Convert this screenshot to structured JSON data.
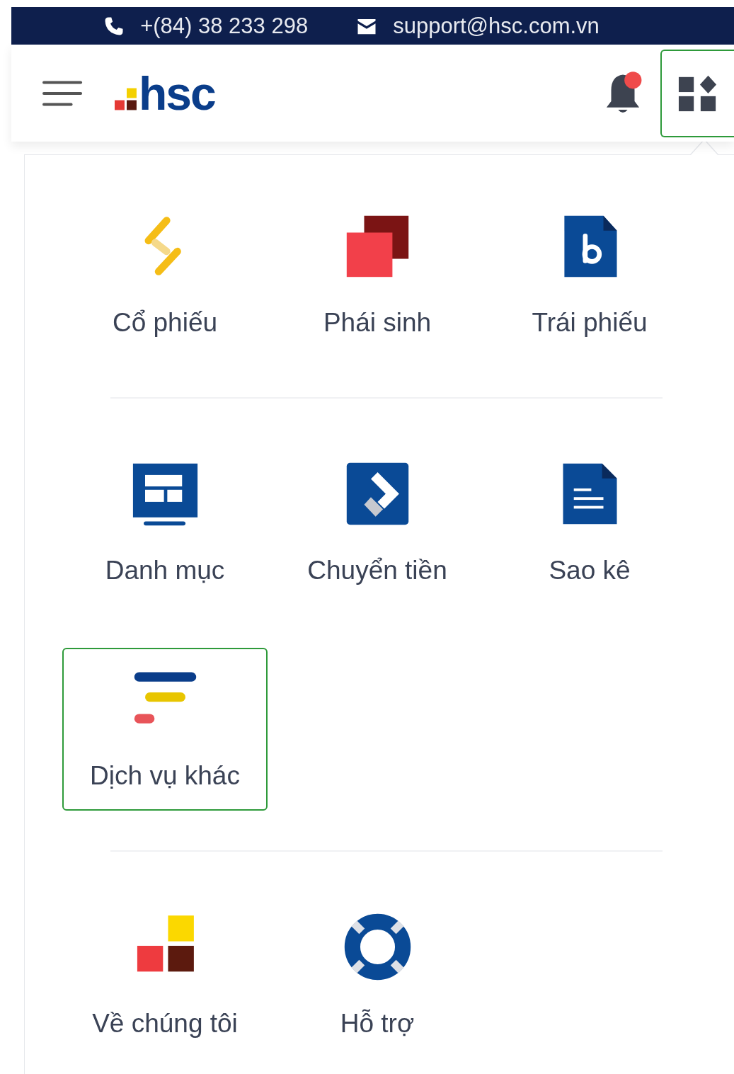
{
  "top_bar": {
    "phone": "+(84) 38 233 298",
    "email": "support@hsc.com.vn"
  },
  "header": {
    "logo_text": "hsc",
    "notification_badge": true,
    "apps_button_highlighted": true
  },
  "menu_sections": [
    {
      "items": [
        {
          "label": "Cổ phiếu",
          "kind": "stocks",
          "highlighted": false
        },
        {
          "label": "Phái sinh",
          "kind": "derivatives",
          "highlighted": false
        },
        {
          "label": "Trái phiếu",
          "kind": "bonds",
          "highlighted": false
        }
      ]
    },
    {
      "items": [
        {
          "label": "Danh mục",
          "kind": "portfolio",
          "highlighted": false
        },
        {
          "label": "Chuyển tiền",
          "kind": "transfer",
          "highlighted": false
        },
        {
          "label": "Sao kê",
          "kind": "statement",
          "highlighted": false
        },
        {
          "label": "Dịch vụ khác",
          "kind": "other",
          "highlighted": true
        }
      ]
    },
    {
      "items": [
        {
          "label": "Về chúng tôi",
          "kind": "about",
          "highlighted": false
        },
        {
          "label": "Hỗ trợ",
          "kind": "support",
          "highlighted": false
        }
      ]
    }
  ]
}
